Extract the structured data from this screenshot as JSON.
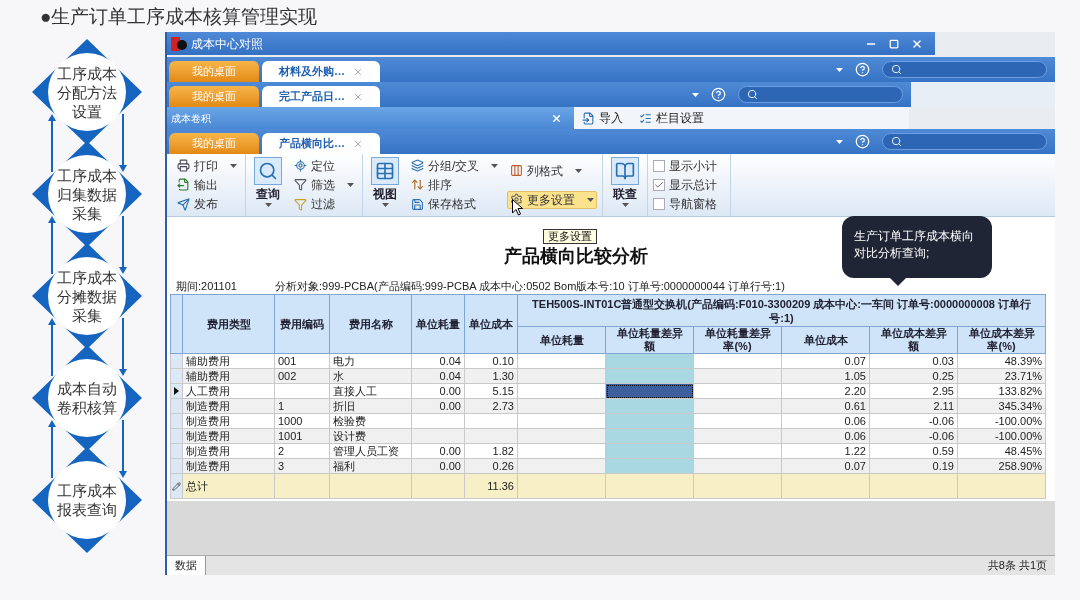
{
  "slide_title": "●生产订单工序成本核算管理实现",
  "steps": [
    {
      "label": "工序成本分配方法设置"
    },
    {
      "label": "工序成本归集数据采集"
    },
    {
      "label": "工序成本分摊数据采集"
    },
    {
      "label": "成本自动卷积核算"
    },
    {
      "label": "工序成本报表查询"
    }
  ],
  "window_title": "成本中心对照",
  "tab_bars": [
    {
      "tabs": [
        {
          "label": "我的桌面",
          "kind": "home",
          "selected": false
        },
        {
          "label": "材料及外购…",
          "kind": "doc",
          "selected": true
        }
      ]
    },
    {
      "tabs": [
        {
          "label": "我的桌面",
          "kind": "home",
          "selected": false
        },
        {
          "label": "完工产品日…",
          "kind": "doc",
          "selected": true
        }
      ]
    },
    {
      "tabs": [
        {
          "label": "我的桌面",
          "kind": "home",
          "selected": false
        },
        {
          "label": "产品横向比…",
          "kind": "doc",
          "selected": true
        }
      ]
    }
  ],
  "dialog_title": "成本卷积",
  "back_toolbar": [
    "导入",
    "栏目设置"
  ],
  "ribbon_groups": [
    {
      "parts": [
        {
          "kind": "column",
          "items": [
            {
              "label": "打印",
              "dropdown": true,
              "hovered": false
            },
            {
              "label": "输出",
              "dropdown": false,
              "hovered": false
            },
            {
              "label": "发布",
              "dropdown": false,
              "hovered": false
            }
          ]
        }
      ]
    },
    {
      "parts": [
        {
          "kind": "large",
          "label": "查询"
        },
        {
          "kind": "column",
          "items": [
            {
              "label": "定位",
              "dropdown": false,
              "hovered": false
            },
            {
              "label": "筛选",
              "dropdown": true,
              "hovered": false
            },
            {
              "label": "过滤",
              "dropdown": false,
              "hovered": false
            }
          ]
        }
      ]
    },
    {
      "parts": [
        {
          "kind": "large",
          "label": "视图"
        },
        {
          "kind": "column",
          "items": [
            {
              "label": "分组/交叉",
              "dropdown": true,
              "hovered": false
            },
            {
              "label": "排序",
              "dropdown": false,
              "hovered": false
            },
            {
              "label": "保存格式",
              "dropdown": false,
              "hovered": false
            }
          ]
        },
        {
          "kind": "column",
          "items": [
            {
              "label": "列格式",
              "dropdown": true,
              "hovered": false
            },
            {
              "label": "更多设置",
              "dropdown": true,
              "hovered": true
            }
          ]
        }
      ]
    },
    {
      "parts": [
        {
          "kind": "large",
          "label": "联查"
        }
      ]
    },
    {
      "parts": [
        {
          "kind": "checks",
          "items": [
            {
              "label": "显示小计",
              "checked": false
            },
            {
              "label": "显示总计",
              "checked": true
            },
            {
              "label": "导航窗格",
              "checked": false
            }
          ]
        }
      ]
    }
  ],
  "tooltip": "更多设置",
  "report_title": "产品横向比较分析",
  "callout": "生产订单工序成本横向对比分析查询;",
  "period": "期间:201101",
  "analysis": "分析对象:999-PCBA(产品编码:999-PCBA 成本中心:0502 Bom版本号:10 订单号:0000000044 订单行号:1)",
  "table": {
    "columns": [
      "费用类型",
      "费用编码",
      "费用名称",
      "单位耗量",
      "单位成本"
    ],
    "group": {
      "title": "TEH500S-INT01C普通型交换机(产品编码:F010-3300209 成本中心:一车间 订单号:0000000008 订单行号:1)",
      "columns": [
        {
          "label": "单位耗量",
          "highlighted": false
        },
        {
          "label": "单位耗量差异额",
          "highlighted": true
        },
        {
          "label": "单位耗量差异率(%)",
          "highlighted": false
        },
        {
          "label": "单位成本",
          "highlighted": false
        },
        {
          "label": "单位成本差异额",
          "highlighted": false
        },
        {
          "label": "单位成本差异率(%)",
          "highlighted": false
        }
      ]
    },
    "rows": [
      {
        "selected": false,
        "cells": [
          "辅助费用",
          "001",
          "电力",
          "0.04",
          "0.10",
          null,
          null,
          null,
          "0.07",
          "0.03",
          "48.39%"
        ]
      },
      {
        "selected": false,
        "cells": [
          "辅助费用",
          "002",
          "水",
          "0.04",
          "1.30",
          null,
          null,
          null,
          "1.05",
          "0.25",
          "23.71%"
        ]
      },
      {
        "selected": true,
        "cells": [
          "人工费用",
          null,
          "直接人工",
          "0.00",
          "5.15",
          null,
          null,
          null,
          "2.20",
          "2.95",
          "133.82%"
        ]
      },
      {
        "selected": false,
        "cells": [
          "制造费用",
          "1",
          "折旧",
          "0.00",
          "2.73",
          null,
          null,
          null,
          "0.61",
          "2.11",
          "345.34%"
        ]
      },
      {
        "selected": false,
        "cells": [
          "制造费用",
          "1000",
          "检验费",
          null,
          null,
          null,
          null,
          null,
          "0.06",
          "-0.06",
          "-100.00%"
        ]
      },
      {
        "selected": false,
        "cells": [
          "制造费用",
          "1001",
          "设计费",
          null,
          null,
          null,
          null,
          null,
          "0.06",
          "-0.06",
          "-100.00%"
        ]
      },
      {
        "selected": false,
        "cells": [
          "制造费用",
          "2",
          "管理人员工资",
          "0.00",
          "1.82",
          null,
          null,
          null,
          "1.22",
          "0.59",
          "48.45%"
        ]
      },
      {
        "selected": false,
        "cells": [
          "制造费用",
          "3",
          "福利",
          "0.00",
          "0.26",
          null,
          null,
          null,
          "0.07",
          "0.19",
          "258.90%"
        ]
      }
    ],
    "total": {
      "cells": [
        "总计",
        null,
        null,
        null,
        "11.36",
        null,
        null,
        null,
        null,
        null,
        null
      ]
    }
  },
  "status_bar": {
    "tab": "数据",
    "summary": "共8条 共1页"
  }
}
